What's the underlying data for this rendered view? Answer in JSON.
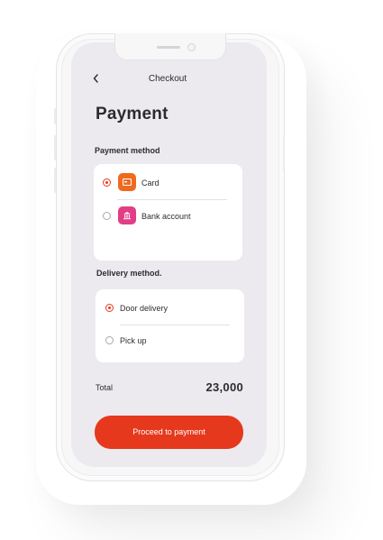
{
  "header": {
    "title": "Checkout",
    "back_icon": "chevron-left-icon"
  },
  "page_title": "Payment",
  "payment_method": {
    "label": "Payment method",
    "options": [
      {
        "label": "Card",
        "icon": "card-icon",
        "icon_color": "#ee6a1f",
        "selected": true
      },
      {
        "label": "Bank account",
        "icon": "bank-icon",
        "icon_color": "#e23d86",
        "selected": false
      }
    ]
  },
  "delivery_method": {
    "label": "Delivery method.",
    "options": [
      {
        "label": "Door delivery",
        "selected": true
      },
      {
        "label": "Pick up",
        "selected": false
      }
    ]
  },
  "total": {
    "label": "Total",
    "value": "23,000"
  },
  "cta": {
    "label": "Proceed to payment"
  },
  "colors": {
    "accent": "#e5381c",
    "screen_bg": "#eceaee",
    "card_bg": "#ffffff"
  }
}
